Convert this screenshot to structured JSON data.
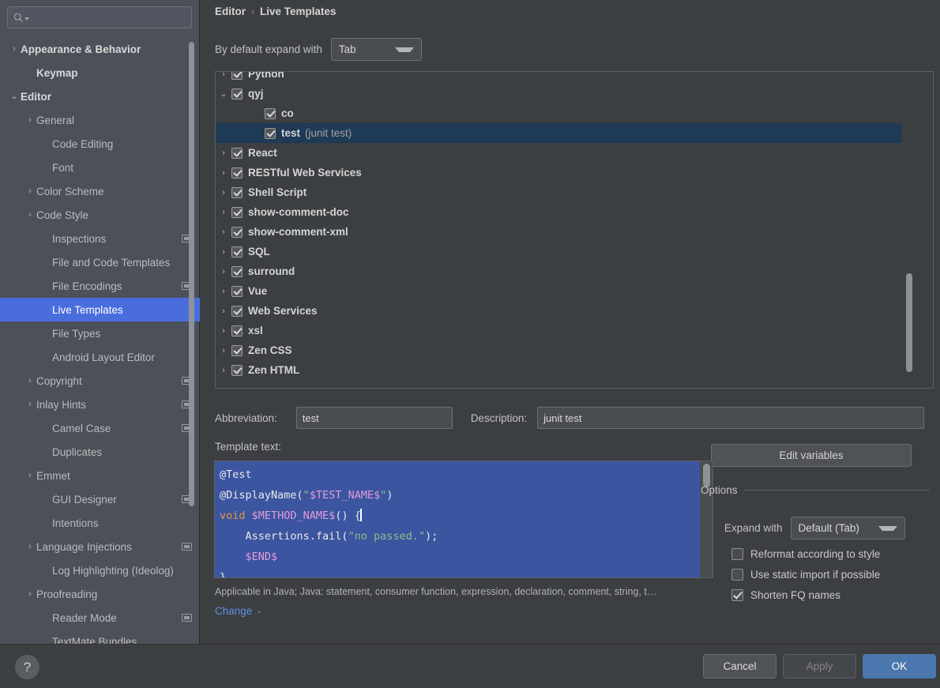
{
  "search": {
    "placeholder": "",
    "value": "",
    "icon": "search-icon"
  },
  "sidebar": {
    "items": [
      {
        "label": "Appearance & Behavior",
        "chevron": "›",
        "indent": 0,
        "bold": true,
        "project_icon": false,
        "selected": false
      },
      {
        "label": "Keymap",
        "chevron": "",
        "indent": 1,
        "bold": true,
        "project_icon": false,
        "selected": false
      },
      {
        "label": "Editor",
        "chevron": "⌄",
        "indent": 0,
        "bold": true,
        "project_icon": false,
        "selected": false
      },
      {
        "label": "General",
        "chevron": "›",
        "indent": 1,
        "bold": false,
        "project_icon": false,
        "selected": false
      },
      {
        "label": "Code Editing",
        "chevron": "",
        "indent": 2,
        "bold": false,
        "project_icon": false,
        "selected": false
      },
      {
        "label": "Font",
        "chevron": "",
        "indent": 2,
        "bold": false,
        "project_icon": false,
        "selected": false
      },
      {
        "label": "Color Scheme",
        "chevron": "›",
        "indent": 1,
        "bold": false,
        "project_icon": false,
        "selected": false
      },
      {
        "label": "Code Style",
        "chevron": "›",
        "indent": 1,
        "bold": false,
        "project_icon": false,
        "selected": false
      },
      {
        "label": "Inspections",
        "chevron": "",
        "indent": 2,
        "bold": false,
        "project_icon": true,
        "selected": false
      },
      {
        "label": "File and Code Templates",
        "chevron": "",
        "indent": 2,
        "bold": false,
        "project_icon": false,
        "selected": false
      },
      {
        "label": "File Encodings",
        "chevron": "",
        "indent": 2,
        "bold": false,
        "project_icon": true,
        "selected": false
      },
      {
        "label": "Live Templates",
        "chevron": "",
        "indent": 2,
        "bold": false,
        "project_icon": false,
        "selected": true
      },
      {
        "label": "File Types",
        "chevron": "",
        "indent": 2,
        "bold": false,
        "project_icon": false,
        "selected": false
      },
      {
        "label": "Android Layout Editor",
        "chevron": "",
        "indent": 2,
        "bold": false,
        "project_icon": false,
        "selected": false
      },
      {
        "label": "Copyright",
        "chevron": "›",
        "indent": 1,
        "bold": false,
        "project_icon": true,
        "selected": false
      },
      {
        "label": "Inlay Hints",
        "chevron": "›",
        "indent": 1,
        "bold": false,
        "project_icon": true,
        "selected": false
      },
      {
        "label": "Camel Case",
        "chevron": "",
        "indent": 2,
        "bold": false,
        "project_icon": true,
        "selected": false
      },
      {
        "label": "Duplicates",
        "chevron": "",
        "indent": 2,
        "bold": false,
        "project_icon": false,
        "selected": false
      },
      {
        "label": "Emmet",
        "chevron": "›",
        "indent": 1,
        "bold": false,
        "project_icon": false,
        "selected": false
      },
      {
        "label": "GUI Designer",
        "chevron": "",
        "indent": 2,
        "bold": false,
        "project_icon": true,
        "selected": false
      },
      {
        "label": "Intentions",
        "chevron": "",
        "indent": 2,
        "bold": false,
        "project_icon": false,
        "selected": false
      },
      {
        "label": "Language Injections",
        "chevron": "›",
        "indent": 1,
        "bold": false,
        "project_icon": true,
        "selected": false
      },
      {
        "label": "Log Highlighting (Ideolog)",
        "chevron": "",
        "indent": 2,
        "bold": false,
        "project_icon": false,
        "selected": false
      },
      {
        "label": "Proofreading",
        "chevron": "›",
        "indent": 1,
        "bold": false,
        "project_icon": false,
        "selected": false
      },
      {
        "label": "Reader Mode",
        "chevron": "",
        "indent": 2,
        "bold": false,
        "project_icon": true,
        "selected": false
      },
      {
        "label": "TextMate Bundles",
        "chevron": "",
        "indent": 2,
        "bold": false,
        "project_icon": false,
        "selected": false
      }
    ],
    "help_label": "?"
  },
  "header": {
    "breadcrumb_root": "Editor",
    "breadcrumb_sep": "›",
    "breadcrumb_current": "Live Templates"
  },
  "expand_row": {
    "label": "By default expand with",
    "value": "Tab"
  },
  "template_tree": {
    "rows": [
      {
        "chevron": "›",
        "checked": true,
        "name": "Python",
        "desc": "",
        "indent": 1,
        "selected": false
      },
      {
        "chevron": "⌄",
        "checked": true,
        "name": "qyj",
        "desc": "",
        "indent": 1,
        "selected": false
      },
      {
        "chevron": "",
        "checked": true,
        "name": "co",
        "desc": "",
        "indent": 2,
        "selected": false
      },
      {
        "chevron": "",
        "checked": true,
        "name": "test",
        "desc": "(junit test)",
        "indent": 2,
        "selected": true
      },
      {
        "chevron": "›",
        "checked": true,
        "name": "React",
        "desc": "",
        "indent": 1,
        "selected": false
      },
      {
        "chevron": "›",
        "checked": true,
        "name": "RESTful Web Services",
        "desc": "",
        "indent": 1,
        "selected": false
      },
      {
        "chevron": "›",
        "checked": true,
        "name": "Shell Script",
        "desc": "",
        "indent": 1,
        "selected": false
      },
      {
        "chevron": "›",
        "checked": true,
        "name": "show-comment-doc",
        "desc": "",
        "indent": 1,
        "selected": false
      },
      {
        "chevron": "›",
        "checked": true,
        "name": "show-comment-xml",
        "desc": "",
        "indent": 1,
        "selected": false
      },
      {
        "chevron": "›",
        "checked": true,
        "name": "SQL",
        "desc": "",
        "indent": 1,
        "selected": false
      },
      {
        "chevron": "›",
        "checked": true,
        "name": "surround",
        "desc": "",
        "indent": 1,
        "selected": false
      },
      {
        "chevron": "›",
        "checked": true,
        "name": "Vue",
        "desc": "",
        "indent": 1,
        "selected": false
      },
      {
        "chevron": "›",
        "checked": true,
        "name": "Web Services",
        "desc": "",
        "indent": 1,
        "selected": false
      },
      {
        "chevron": "›",
        "checked": true,
        "name": "xsl",
        "desc": "",
        "indent": 1,
        "selected": false
      },
      {
        "chevron": "›",
        "checked": true,
        "name": "Zen CSS",
        "desc": "",
        "indent": 1,
        "selected": false
      },
      {
        "chevron": "›",
        "checked": true,
        "name": "Zen HTML",
        "desc": "",
        "indent": 1,
        "selected": false
      }
    ],
    "toolbar": [
      {
        "icon": "plus-icon",
        "glyph": "+"
      },
      {
        "icon": "minus-icon",
        "glyph": "−"
      },
      {
        "icon": "copy-icon",
        "glyph": "❐"
      },
      {
        "icon": "revert-icon",
        "glyph": "↩"
      }
    ]
  },
  "fields": {
    "abbreviation_label": "Abbreviation:",
    "abbreviation_value": "test",
    "description_label": "Description:",
    "description_value": "junit test",
    "template_text_label": "Template text:",
    "edit_variables_label": "Edit variables"
  },
  "code": {
    "lines": [
      [
        {
          "t": "@Test",
          "c": "ann"
        }
      ],
      [
        {
          "t": "@DisplayName(",
          "c": "ann"
        },
        {
          "t": "\"",
          "c": "str"
        },
        {
          "t": "$TEST_NAME$",
          "c": "var"
        },
        {
          "t": "\"",
          "c": "str"
        },
        {
          "t": ")",
          "c": "ann"
        }
      ],
      [
        {
          "t": "void ",
          "c": "kw"
        },
        {
          "t": "$METHOD_NAME$",
          "c": "var"
        },
        {
          "t": "() {",
          "c": "plain"
        },
        {
          "t": "CARET",
          "c": "caret"
        }
      ],
      [
        {
          "t": "    Assertions.fail(",
          "c": "plain"
        },
        {
          "t": "\"no passed.\"",
          "c": "str"
        },
        {
          "t": ");",
          "c": "plain"
        }
      ],
      [
        {
          "t": "    ",
          "c": "plain"
        },
        {
          "t": "$END$",
          "c": "var"
        }
      ],
      [
        {
          "t": "}",
          "c": "plain"
        }
      ]
    ]
  },
  "applicable": {
    "text": "Applicable in Java; Java: statement, consumer function, expression, declaration, comment, string, t…",
    "change_label": "Change",
    "change_chevron": "⌄"
  },
  "options": {
    "title": "Options",
    "expand_with_label": "Expand with",
    "expand_with_value": "Default (Tab)",
    "checkboxes": [
      {
        "label": "Reformat according to style",
        "checked": false
      },
      {
        "label": "Use static import if possible",
        "checked": false
      },
      {
        "label": "Shorten FQ names",
        "checked": true
      }
    ]
  },
  "footer": {
    "cancel": "Cancel",
    "apply": "Apply",
    "ok": "OK"
  },
  "colors": {
    "accent_blue": "#4a6ddd",
    "selection_navy": "#1e3a55",
    "ok_button": "#4a77ad",
    "link_blue": "#5b8fe0",
    "code_bg": "#3b55a0"
  }
}
